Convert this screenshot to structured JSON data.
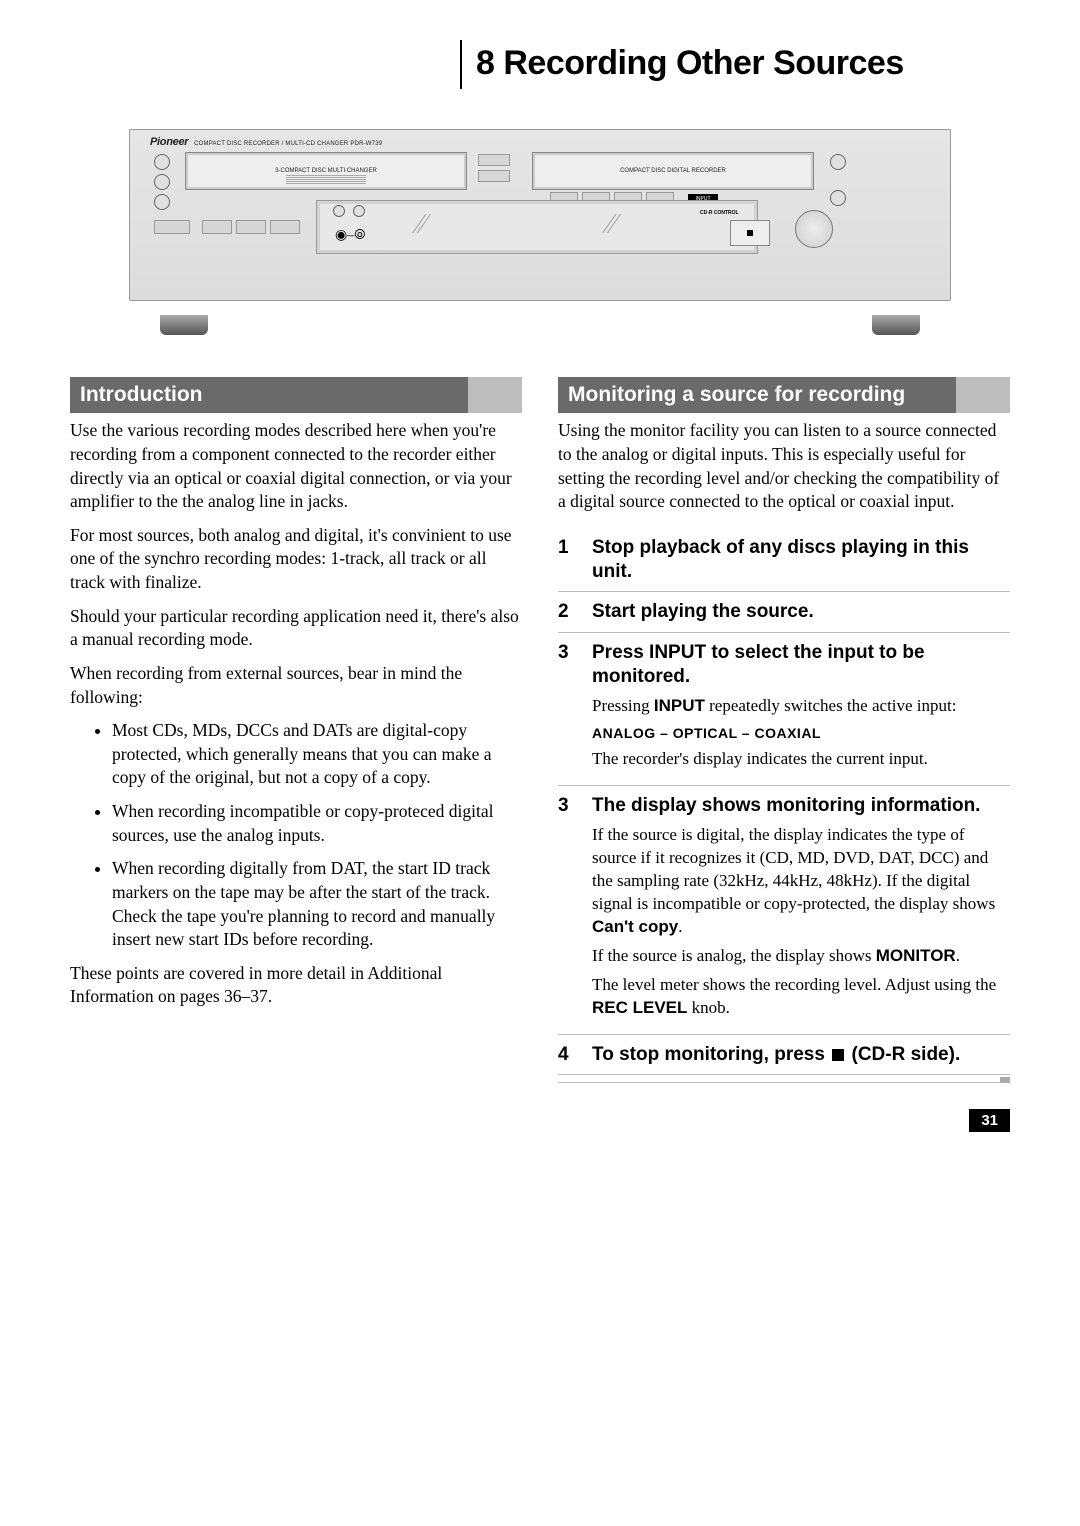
{
  "chapter": {
    "number": "8",
    "title": "Recording Other Sources"
  },
  "device": {
    "brand": "Pioneer",
    "model_line": "COMPACT DISC RECORDER / MULTI-CD CHANGER  PDR-W739",
    "tray_left_label": "3-COMPACT DISC MULTI CHANGER",
    "tray_right_label": "COMPACT DISC DIGITAL RECORDER",
    "input_label": "INPUT",
    "cdr_label": "CD-R CONTROL"
  },
  "left": {
    "heading": "Introduction",
    "p1": "Use the various recording modes described here when you're recording from a component connected to the recorder either directly via an optical or coaxial digital connection, or via your amplifier to the the analog line in jacks.",
    "p2": "For most sources, both analog and digital, it's convinient to use one of the synchro recording modes: 1-track, all track or all track with finalize.",
    "p3": "Should your particular recording application need it, there's also a manual recording mode.",
    "p4": "When recording from external sources, bear in mind the following:",
    "bullets": [
      "Most CDs, MDs, DCCs and DATs are digital-copy protected, which generally means that you can make a copy of the original, but not a copy of a copy.",
      "When recording incompatible or copy-proteced digital sources, use the analog inputs.",
      "When recording digitally from DAT, the start ID track markers on the tape may be after the start of the track. Check the tape you're planning to record and manually insert new start IDs before recording."
    ],
    "p5": "These points are covered in more detail in Additional Information on pages 36–37."
  },
  "right": {
    "heading": "Monitoring a source for recording",
    "p1": "Using the monitor facility you can listen to a source connected to the analog or digital inputs. This is especially useful  for setting the recording level and/or checking the compatibility of a digital source connected to the optical or coaxial input.",
    "steps": [
      {
        "n": "1",
        "title": "Stop playback of any discs playing in this unit."
      },
      {
        "n": "2",
        "title": "Start playing the source."
      },
      {
        "n": "3",
        "title": "Press INPUT to select the input to be monitored.",
        "body_pre": "Pressing ",
        "body_bold1": "INPUT",
        "body_post1": "  repeatedly switches the active input:",
        "seq": "ANALOG – OPTICAL – COAXIAL",
        "body2": "The recorder's display indicates the current input."
      },
      {
        "n": "3",
        "title": "The display shows monitoring information.",
        "body3a": "If the source is digital, the display indicates the type of source if it recognizes it (CD, MD, DVD, DAT, DCC) and the sampling rate (32kHz, 44kHz, 48kHz). If the digital signal is incompatible or copy-protected, the display shows",
        "cant": "Can't copy",
        "body3b_pre": "If the source is analog, the display shows ",
        "body3b_bold": "MONITOR",
        "body3c_pre": "The level meter shows the recording level. Adjust using the ",
        "body3c_bold": "REC LEVEL",
        "body3c_post": " knob."
      },
      {
        "n": "4",
        "title_pre": "To stop monitoring, press ",
        "title_post": " (CD-R side)."
      }
    ]
  },
  "page_number": "31"
}
